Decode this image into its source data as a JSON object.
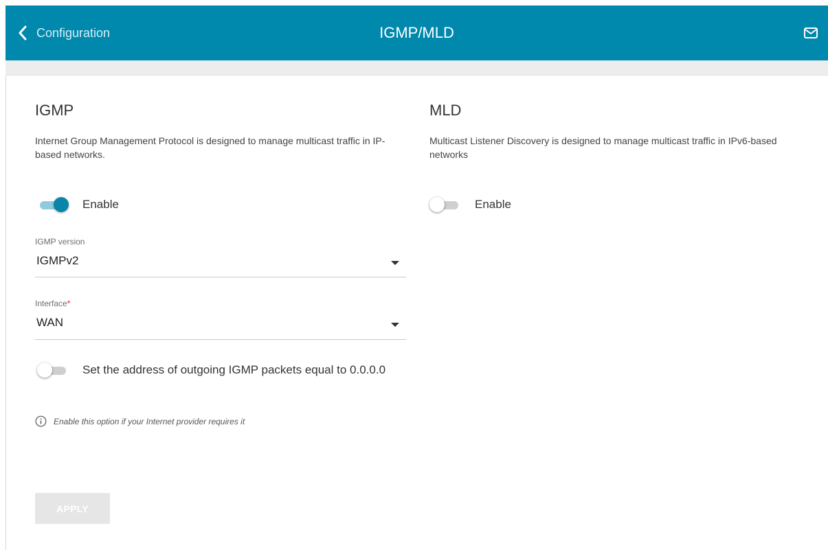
{
  "header": {
    "back_label": "Configuration",
    "title": "IGMP/MLD",
    "background": "#0088ad"
  },
  "igmp": {
    "heading": "IGMP",
    "description": "Internet Group Management Protocol is designed to manage multicast traffic in IP-based networks.",
    "enable": {
      "label": "Enable",
      "on": true
    },
    "version": {
      "label": "IGMP version",
      "value": "IGMPv2"
    },
    "interface": {
      "label": "Interface",
      "required_mark": "*",
      "value": "WAN"
    },
    "address_zero": {
      "label": "Set the address of outgoing IGMP packets equal to 0.0.0.0",
      "on": false
    },
    "hint": "Enable this option if your Internet provider requires it",
    "apply_label": "APPLY"
  },
  "mld": {
    "heading": "MLD",
    "description": "Multicast Listener Discovery is designed to manage multicast traffic in IPv6-based networks",
    "enable": {
      "label": "Enable",
      "on": false
    }
  },
  "icons": {
    "back": "chevron-left-icon",
    "mail": "envelope-icon",
    "hint": "info-circle-icon",
    "dropdown": "caret-down-icon"
  }
}
